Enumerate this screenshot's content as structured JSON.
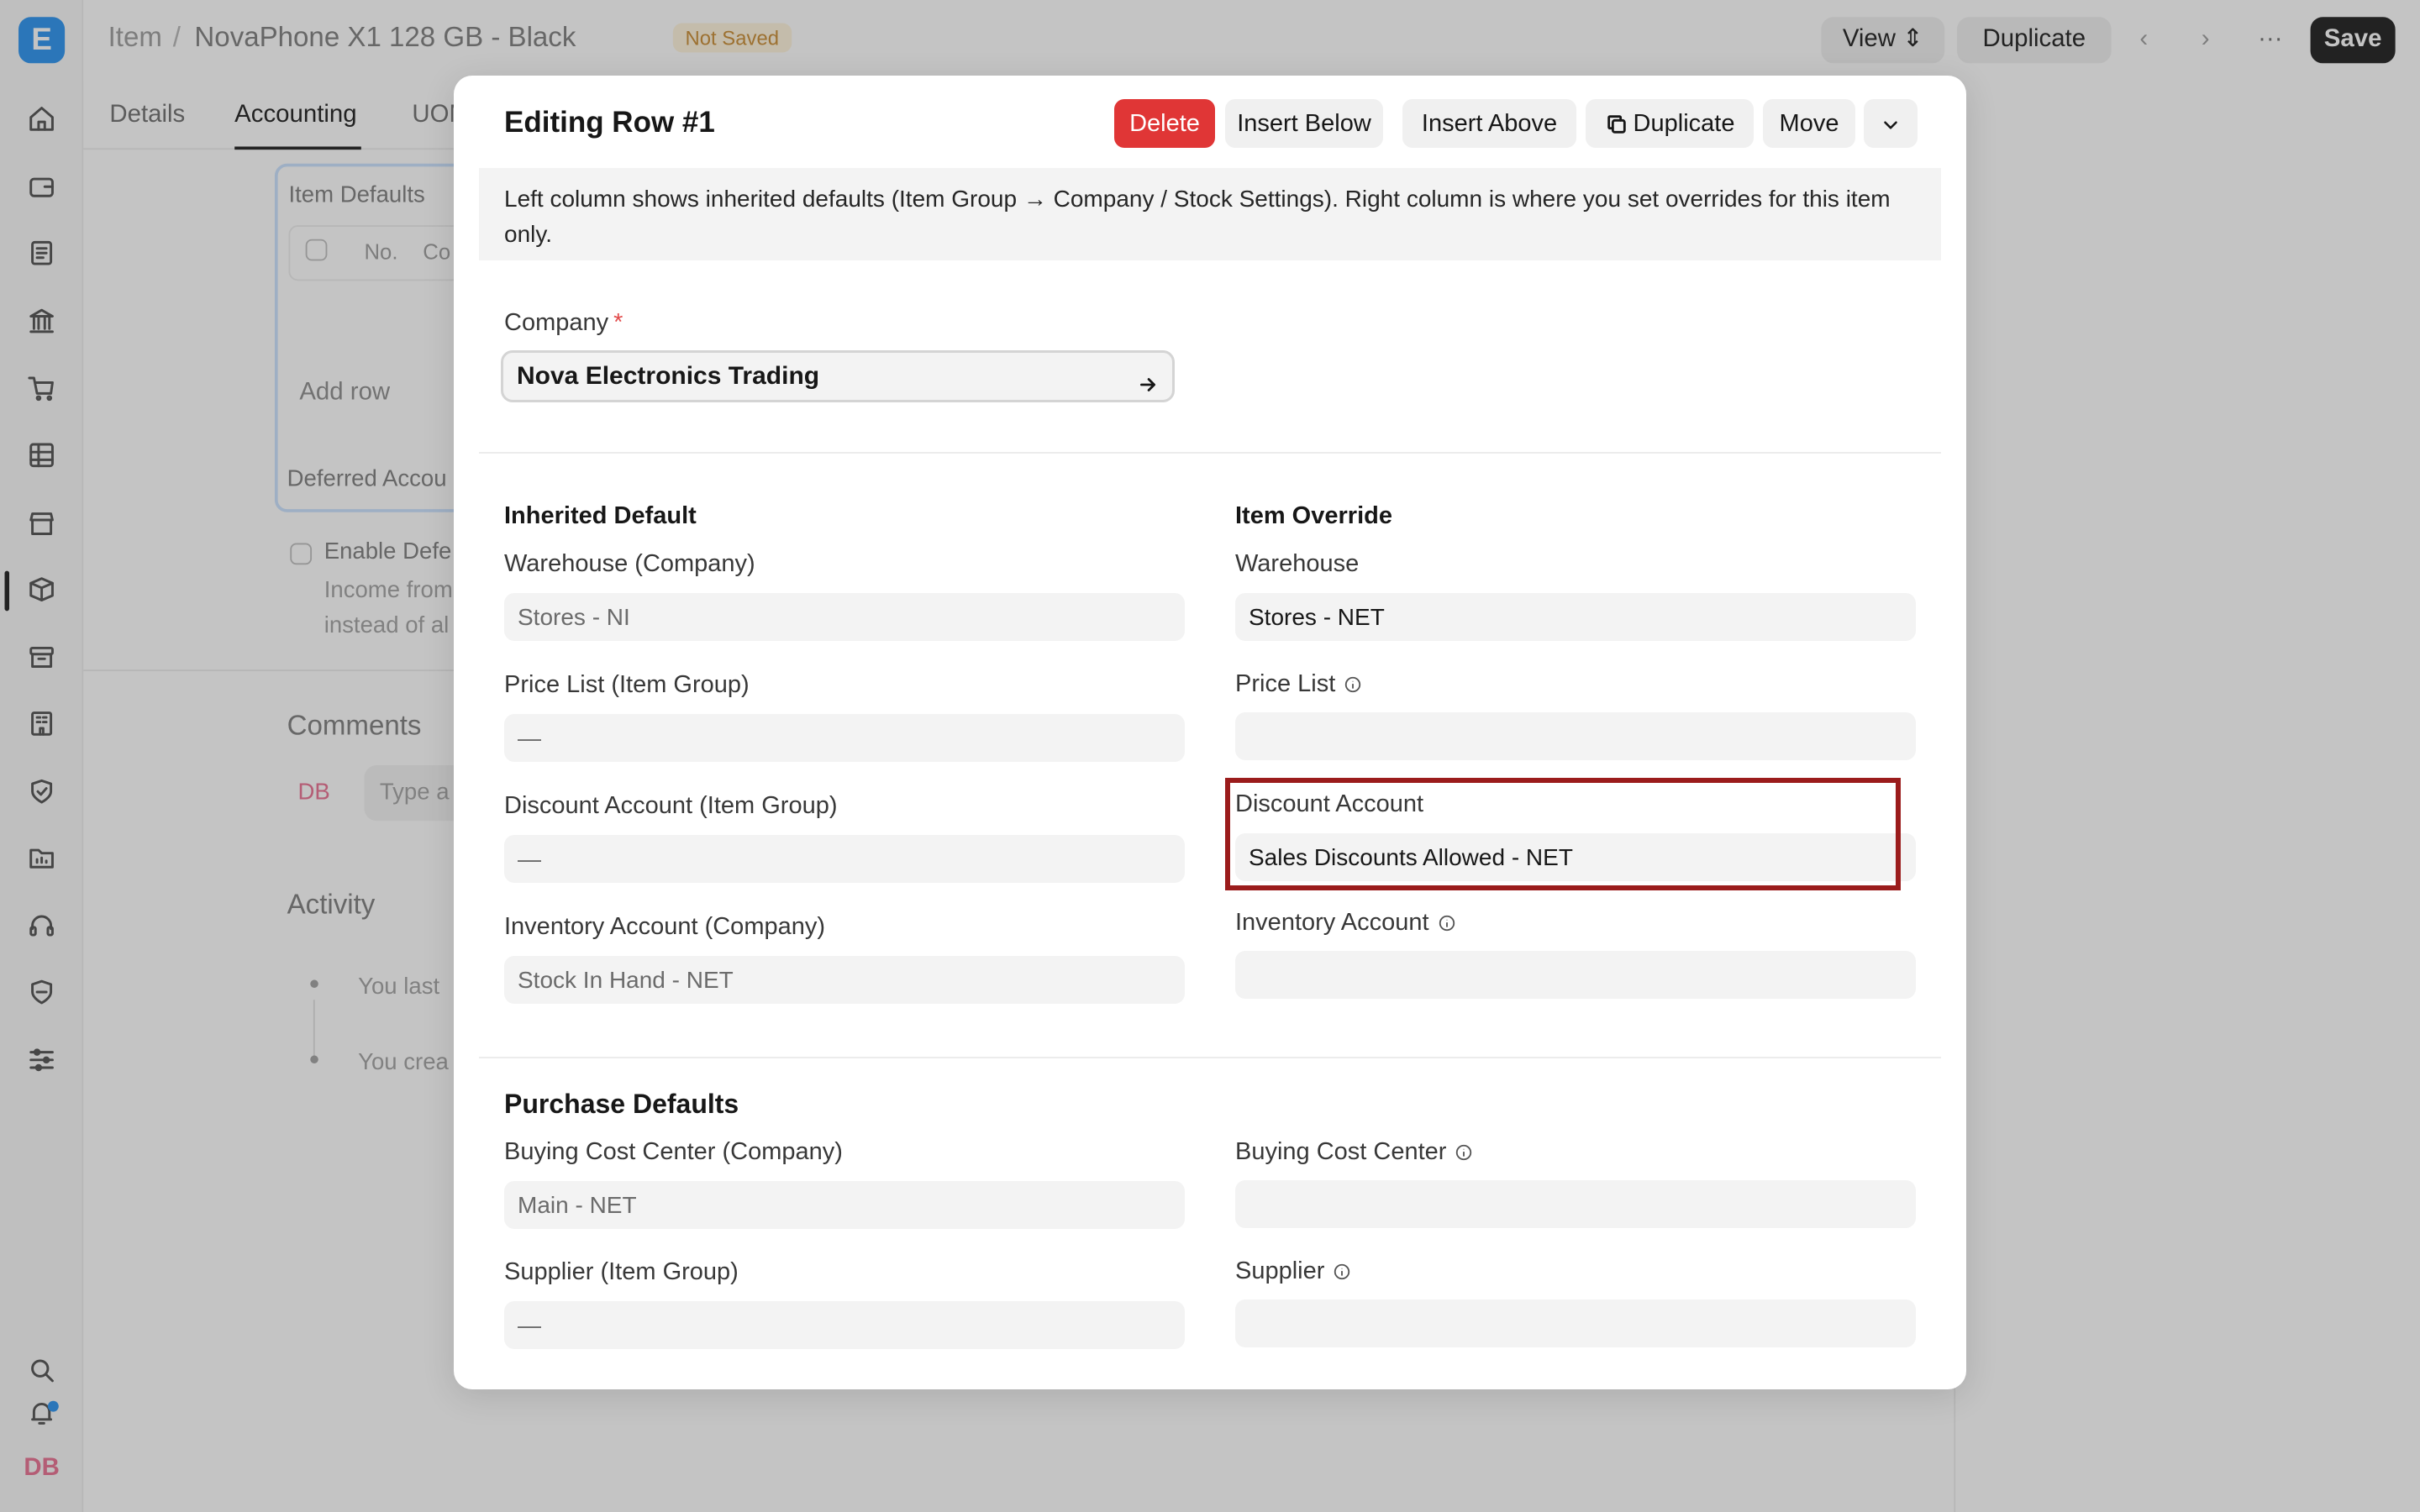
{
  "background": {
    "logo_letter": "E",
    "breadcrumb": {
      "root": "Item",
      "separator": "/",
      "doc_title": "NovaPhone X1 128 GB - Black",
      "status": "Not Saved"
    },
    "toolbar": {
      "view": "View",
      "duplicate": "Duplicate",
      "more": "···",
      "save": "Save"
    },
    "tabs": [
      "Details",
      "Accounting",
      "UOM"
    ],
    "item_defaults": {
      "title": "Item Defaults",
      "col_no": "No.",
      "col_company": "Co",
      "add_row": "Add row"
    },
    "deferred": {
      "title": "Deferred Accou",
      "checkbox_label": "Enable Defe",
      "desc_1": "Income from",
      "desc_2": "instead of al"
    },
    "comments": {
      "title": "Comments",
      "avatar": "DB",
      "placeholder": "Type a"
    },
    "activity": {
      "title": "Activity",
      "items": [
        "You last",
        "You crea"
      ]
    },
    "sidebar_avatar": "DB"
  },
  "modal": {
    "title": "Editing Row #1",
    "actions": {
      "delete": "Delete",
      "insert_below": "Insert Below",
      "insert_above": "Insert Above",
      "duplicate": "Duplicate",
      "move": "Move"
    },
    "info": "Left column shows inherited defaults (Item Group → Company / Stock Settings). Right column is where you set overrides for this item only.",
    "company": {
      "label": "Company",
      "required_mark": "*",
      "value": "Nova Electronics Trading"
    },
    "inherited": {
      "heading": "Inherited Default",
      "warehouse": {
        "label": "Warehouse (Company)",
        "value": "Stores - NI"
      },
      "price_list": {
        "label": "Price List (Item Group)",
        "value": "—"
      },
      "discount_account": {
        "label": "Discount Account (Item Group)",
        "value": "—"
      },
      "inventory_account": {
        "label": "Inventory Account (Company)",
        "value": "Stock In Hand - NET"
      }
    },
    "override": {
      "heading": "Item Override",
      "warehouse": {
        "label": "Warehouse",
        "value": "Stores - NET"
      },
      "price_list": {
        "label": "Price List",
        "value": ""
      },
      "discount_account": {
        "label": "Discount Account",
        "value": "Sales Discounts Allowed - NET"
      },
      "inventory_account": {
        "label": "Inventory Account",
        "value": ""
      }
    },
    "purchase": {
      "heading": "Purchase Defaults",
      "buying_cost_center_inherited": {
        "label": "Buying Cost Center (Company)",
        "value": "Main - NET"
      },
      "buying_cost_center": {
        "label": "Buying Cost Center",
        "value": ""
      },
      "supplier_inherited": {
        "label": "Supplier (Item Group)",
        "value": "—"
      },
      "supplier": {
        "label": "Supplier",
        "value": ""
      }
    }
  },
  "colors": {
    "accent": "#2490ef",
    "danger": "#e03636",
    "highlight_box": "#9b1c1c",
    "not_saved_text": "#c7882d"
  }
}
